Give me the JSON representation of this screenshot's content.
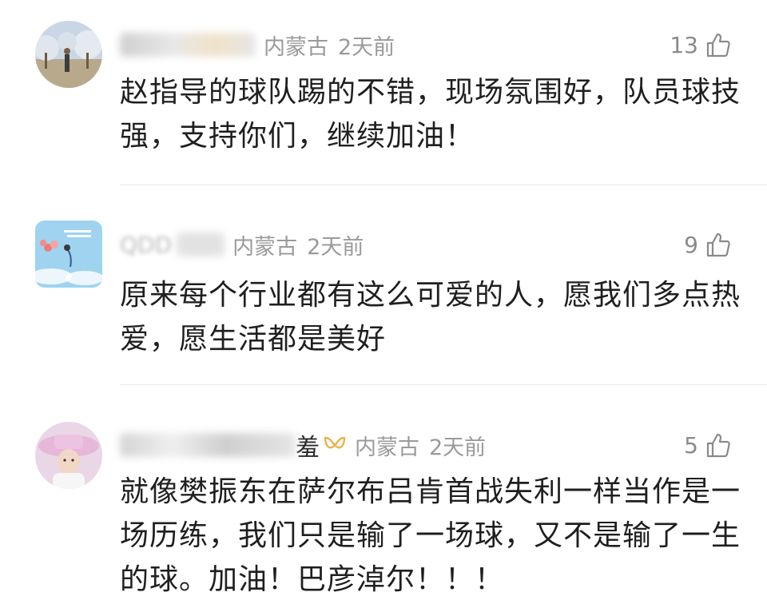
{
  "comments": [
    {
      "location": "内蒙古",
      "time": "2天前",
      "likes": "13",
      "text": "赵指导的球队踢的不错，现场氛围好，队员球技强，支持你们，继续加油！"
    },
    {
      "name_partial": "QDD",
      "location": "内蒙古",
      "time": "2天前",
      "likes": "9",
      "text": "原来每个行业都有这么可爱的人，愿我们多点热爱，愿生活都是美好"
    },
    {
      "name_suffix": "羞",
      "location": "内蒙古",
      "time": "2天前",
      "likes": "5",
      "text": "就像樊振东在萨尔布吕肯首战失利一样当作是一场历练，我们只是输了一场球，又不是输了一生的球。加油！巴彦淖尔！！！"
    }
  ],
  "icons": {
    "like": "thumbs-up-icon",
    "badge": "svip-badge-icon"
  },
  "colors": {
    "meta_gray": "#9a9a9a",
    "text": "#1f1f1f",
    "badge_gold": "#e8b34a"
  }
}
